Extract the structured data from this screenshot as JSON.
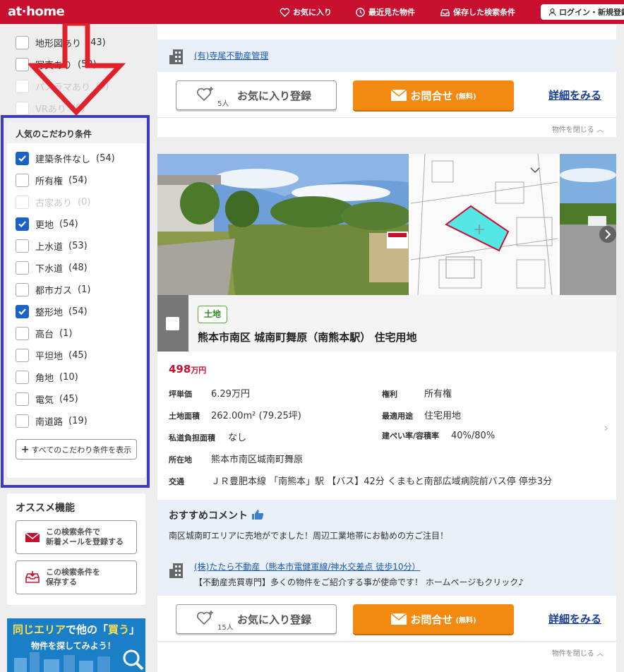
{
  "header": {
    "logo": "at·home",
    "nav": [
      "お気に入り",
      "最近見た物件",
      "保存した検索条件"
    ],
    "login": "ログイン・新規登録"
  },
  "sidebar_top": [
    {
      "label": "地形図あり",
      "count": "(43)",
      "checked": false,
      "disabled": false
    },
    {
      "label": "写真あり",
      "count": "(52)",
      "checked": false,
      "disabled": false
    },
    {
      "label": "パノラマあり",
      "count": "(0)",
      "checked": false,
      "disabled": true
    },
    {
      "label": "VRあり",
      "count": "(0)",
      "checked": false,
      "disabled": true
    }
  ],
  "popular": {
    "title": "人気のこだわり条件",
    "items": [
      {
        "label": "建築条件なし",
        "count": "(54)",
        "checked": true,
        "disabled": false
      },
      {
        "label": "所有権",
        "count": "(54)",
        "checked": false,
        "disabled": false
      },
      {
        "label": "古家あり",
        "count": "(0)",
        "checked": false,
        "disabled": true
      },
      {
        "label": "更地",
        "count": "(54)",
        "checked": true,
        "disabled": false
      },
      {
        "label": "上水道",
        "count": "(53)",
        "checked": false,
        "disabled": false
      },
      {
        "label": "下水道",
        "count": "(48)",
        "checked": false,
        "disabled": false
      },
      {
        "label": "都市ガス",
        "count": "(1)",
        "checked": false,
        "disabled": false
      },
      {
        "label": "整形地",
        "count": "(54)",
        "checked": true,
        "disabled": false
      },
      {
        "label": "高台",
        "count": "(1)",
        "checked": false,
        "disabled": false
      },
      {
        "label": "平坦地",
        "count": "(45)",
        "checked": false,
        "disabled": false
      },
      {
        "label": "角地",
        "count": "(10)",
        "checked": false,
        "disabled": false
      },
      {
        "label": "電気",
        "count": "(45)",
        "checked": false,
        "disabled": false
      },
      {
        "label": "南道路",
        "count": "(19)",
        "checked": false,
        "disabled": false
      }
    ],
    "show_all": "すべてのこだわり条件を表示"
  },
  "recommend": {
    "title": "オススメ機能",
    "mail_l1": "この検索条件で",
    "mail_l2": "新着メールを登録する",
    "save_l1": "この検索条件を",
    "save_l2": "保存する"
  },
  "banner": {
    "pre": "同じエリア",
    "mid": "で他の「",
    "hl": "買う",
    "post": "」",
    "line2": "物件を探してみよう！"
  },
  "card1": {
    "company": "(有)寺尾不動産管理",
    "fav_label": "お気に入り登録",
    "fav_count": "5人",
    "inquire": "お問合せ",
    "inquire_note": "(無料)",
    "detail": "詳細をみる",
    "close": "物件を閉じる"
  },
  "card2": {
    "tag": "土地",
    "title": "熊本市南区 城南町舞原（南熊本駅） 住宅用地",
    "price_num": "498",
    "price_unit": "万円",
    "details": {
      "tsubo_k": "坪単価",
      "tsubo_v": "6.29万円",
      "right_k": "権利",
      "right_v": "所有権",
      "area_k": "土地面積",
      "area_v": "262.00m² (79.25坪)",
      "use_k": "最適用途",
      "use_v": "住宅用地",
      "road_k": "私道負担面積",
      "road_v": "なし",
      "ratio_k": "建ぺい率/容積率",
      "ratio_v": "40%/80%",
      "addr_k": "所在地",
      "addr_v": "熊本市南区城南町舞原",
      "access_k": "交通",
      "access_v": "ＪＲ豊肥本線 「南熊本」駅 【バス】42分 くまもと南部広域病院前バス停 停歩3分"
    },
    "recommend_title": "おすすめコメント",
    "recommend_body": "南区城南町エリアに売地がでました！周辺工業地帯にお勧めの方ご注目！",
    "company": "(株)たたら不動産（熊本市電健軍線/神水交差点 徒歩10分）",
    "company_desc": "【不動産売買専門】多くの物件をご紹介する事が使命です！ ホームページもクリック♪",
    "fav_label": "お気に入り登録",
    "fav_count": "15人",
    "inquire": "お問合せ",
    "inquire_note": "(無料)",
    "detail": "詳細をみる",
    "close": "物件を閉じる"
  },
  "colors": {
    "brand": "#c8102e",
    "check": "#1a63c4",
    "inquire": "#f28a12",
    "annotation_arrow": "#e0202a",
    "annotation_frame": "#3b3bc7"
  }
}
